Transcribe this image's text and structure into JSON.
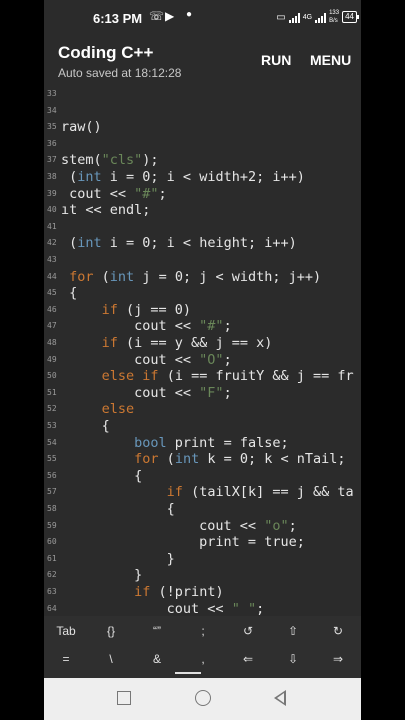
{
  "status": {
    "time": "6:13 PM",
    "net_speed_top": "133",
    "net_speed_bottom": "B/s",
    "net_type": "4G",
    "battery": "44"
  },
  "app": {
    "title": "Coding C++",
    "subtitle": "Auto saved at 18:12:28",
    "run_label": "RUN",
    "menu_label": "MENU"
  },
  "editor": {
    "lines": [
      {
        "n": "33",
        "code": ""
      },
      {
        "n": "34",
        "code": ""
      },
      {
        "n": "35",
        "code": "raw()"
      },
      {
        "n": "36",
        "code": ""
      },
      {
        "n": "37",
        "code": "stem(\"cls\");"
      },
      {
        "n": "38",
        "code": " (int i = 0; i < width+2; i++)"
      },
      {
        "n": "39",
        "code": " cout << \"#\";"
      },
      {
        "n": "40",
        "code": "ıt << endl;"
      },
      {
        "n": "41",
        "code": ""
      },
      {
        "n": "42",
        "code": " (int i = 0; i < height; i++)"
      },
      {
        "n": "43",
        "code": ""
      },
      {
        "n": "44",
        "code": " for (int j = 0; j < width; j++)"
      },
      {
        "n": "45",
        "code": " {"
      },
      {
        "n": "46",
        "code": "     if (j == 0)"
      },
      {
        "n": "47",
        "code": "         cout << \"#\";"
      },
      {
        "n": "48",
        "code": "     if (i == y && j == x)"
      },
      {
        "n": "49",
        "code": "         cout << \"O\";"
      },
      {
        "n": "50",
        "code": "     else if (i == fruitY && j == fr"
      },
      {
        "n": "51",
        "code": "         cout << \"F\";"
      },
      {
        "n": "52",
        "code": "     else"
      },
      {
        "n": "53",
        "code": "     {"
      },
      {
        "n": "54",
        "code": "         bool print = false;"
      },
      {
        "n": "55",
        "code": "         for (int k = 0; k < nTail;"
      },
      {
        "n": "56",
        "code": "         {"
      },
      {
        "n": "57",
        "code": "             if (tailX[k] == j && ta"
      },
      {
        "n": "58",
        "code": "             {"
      },
      {
        "n": "59",
        "code": "                 cout << \"o\";"
      },
      {
        "n": "60",
        "code": "                 print = true;"
      },
      {
        "n": "61",
        "code": "             }"
      },
      {
        "n": "62",
        "code": "         }"
      },
      {
        "n": "63",
        "code": "         if (!print)"
      },
      {
        "n": "64",
        "code": "             cout << \" \";"
      }
    ]
  },
  "keys": {
    "row1": [
      "Tab",
      "{}",
      "“”",
      ";",
      "↺",
      "⇧",
      "↻"
    ],
    "row2": [
      "=",
      "\\",
      "&",
      ",",
      "⇐",
      "⇩",
      "⇒"
    ]
  },
  "colors": {
    "background": "#2b2b2b",
    "keyword": "#cc7832",
    "type": "#6897bb",
    "string": "#6a8759",
    "text": "#e6e6e6"
  }
}
